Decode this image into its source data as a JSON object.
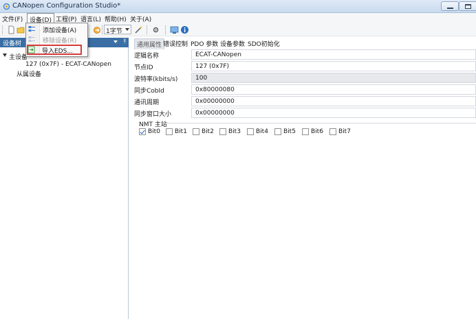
{
  "window": {
    "title": "CANopen Configuration Studio*"
  },
  "menubar": {
    "items": [
      "文件(F)",
      "设备(D)",
      "工程(P)",
      "语言(L)",
      "帮助(H)",
      "关于(A)"
    ]
  },
  "toolbar": {
    "byte_combo": "1字节"
  },
  "device_menu": {
    "items": [
      {
        "label": "添加设备(A)",
        "enabled": true
      },
      {
        "label": "移除设备(R)",
        "enabled": false
      },
      {
        "label": "导入EDS...",
        "enabled": true
      }
    ]
  },
  "left_panel": {
    "header": "设备树",
    "tree": {
      "master": "主设备",
      "node": "127 (0x7F) - ECAT-CANopen",
      "slave": "从属设备"
    }
  },
  "tabs": [
    "通用属性",
    "错误控制",
    "PDO 参数",
    "设备参数",
    "SDO初始化"
  ],
  "properties": [
    {
      "label": "逻辑名称",
      "value": "ECAT-CANopen"
    },
    {
      "label": "节点ID",
      "value": "127 (0x7F)"
    },
    {
      "label": "波特率(kbits/s)",
      "value": "100"
    },
    {
      "label": "同步CobId",
      "value": "0x80000080"
    },
    {
      "label": "通讯周期",
      "value": "0x00000000"
    },
    {
      "label": "同步窗口大小",
      "value": "0x00000000"
    }
  ],
  "nmt": {
    "title": "NMT 主站",
    "bits": [
      {
        "label": "Bit0",
        "checked": true
      },
      {
        "label": "Bit1",
        "checked": false
      },
      {
        "label": "Bit2",
        "checked": false
      },
      {
        "label": "Bit3",
        "checked": false
      },
      {
        "label": "Bit4",
        "checked": false
      },
      {
        "label": "Bit5",
        "checked": false
      },
      {
        "label": "Bit6",
        "checked": false
      },
      {
        "label": "Bit7",
        "checked": false
      }
    ]
  },
  "colors": {
    "panel_header": "#3a6ea5",
    "highlight_border": "#d93a3a"
  }
}
